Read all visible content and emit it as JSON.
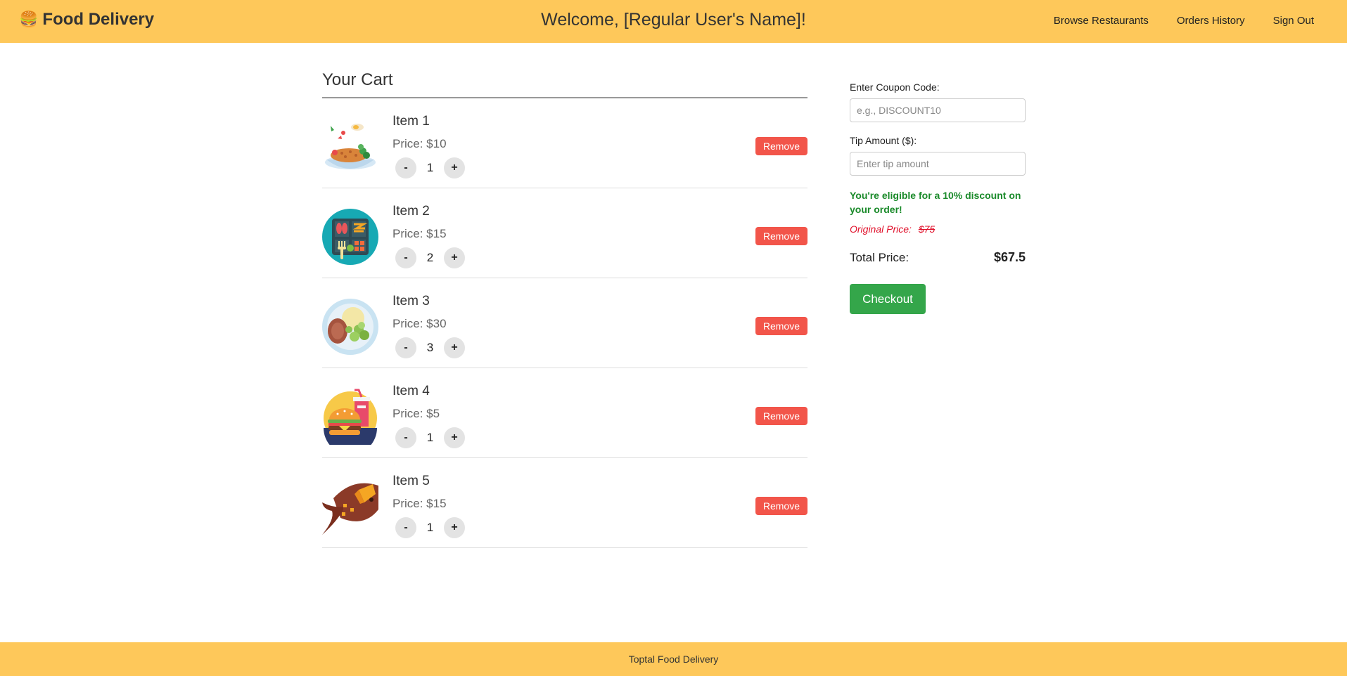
{
  "header": {
    "brand_icon": "🍔",
    "brand_name": "Food Delivery",
    "welcome": "Welcome, [Regular User's Name]!",
    "nav": [
      "Browse Restaurants",
      "Orders History",
      "Sign Out"
    ]
  },
  "cart": {
    "title": "Your Cart",
    "remove_label": "Remove",
    "minus_label": "-",
    "plus_label": "+",
    "items": [
      {
        "name": "Item 1",
        "price": "Price: $10",
        "quantity": "1",
        "image": "rice-plate-icon"
      },
      {
        "name": "Item 2",
        "price": "Price: $15",
        "quantity": "2",
        "image": "bento-box-icon"
      },
      {
        "name": "Item 3",
        "price": "Price: $30",
        "quantity": "3",
        "image": "steak-salad-plate-icon"
      },
      {
        "name": "Item 4",
        "price": "Price: $5",
        "quantity": "1",
        "image": "burger-soda-icon"
      },
      {
        "name": "Item 5",
        "price": "Price: $15",
        "quantity": "1",
        "image": "roasted-fish-icon"
      }
    ]
  },
  "sidebar": {
    "coupon_label": "Enter Coupon Code:",
    "coupon_placeholder": "e.g., DISCOUNT10",
    "tip_label": "Tip Amount ($):",
    "tip_placeholder": "Enter tip amount",
    "discount_message": "You're eligible for a 10% discount on your order!",
    "original_price_label": "Original Price:",
    "original_price_value": "$75",
    "total_label": "Total Price:",
    "total_value": "$67.5",
    "checkout_label": "Checkout"
  },
  "footer": {
    "text": "Toptal Food Delivery"
  },
  "colors": {
    "header_bg": "#fec85a",
    "remove": "#f2554a",
    "checkout": "#34a64a",
    "discount_text": "#1a8a2a",
    "original_price_text": "#e0102a"
  }
}
